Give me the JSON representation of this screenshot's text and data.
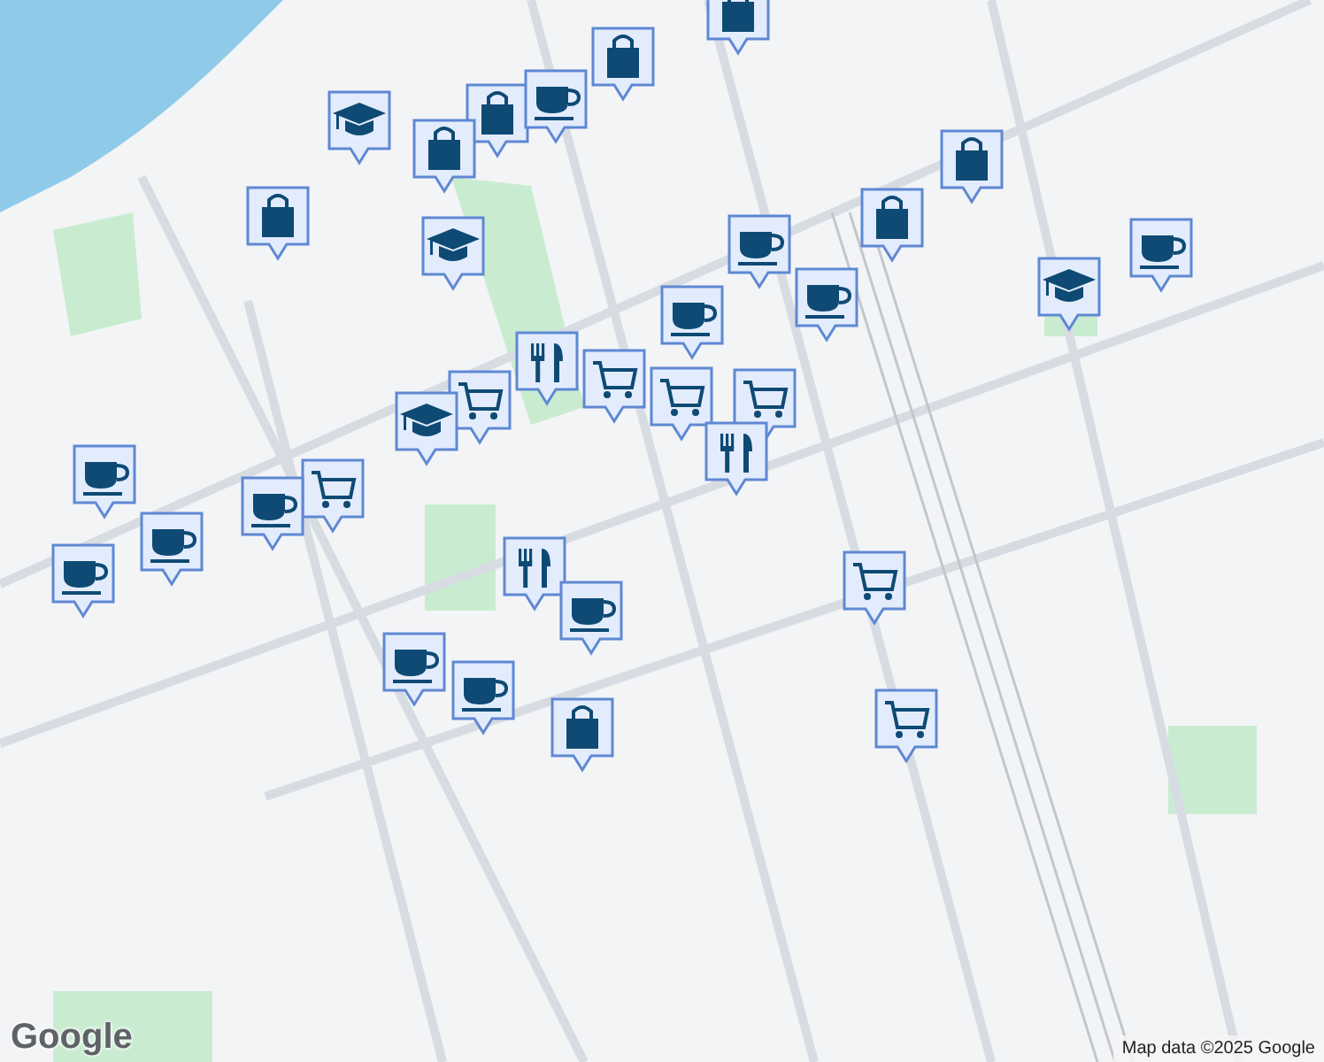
{
  "map": {
    "markers": [
      {
        "kind": "bag"
      },
      {
        "kind": "bag"
      },
      {
        "kind": "school"
      },
      {
        "kind": "bag"
      },
      {
        "kind": "cup"
      },
      {
        "kind": "bag"
      },
      {
        "kind": "bag"
      },
      {
        "kind": "school"
      },
      {
        "kind": "bag"
      },
      {
        "kind": "bag"
      },
      {
        "kind": "cup"
      },
      {
        "kind": "school"
      },
      {
        "kind": "cup"
      },
      {
        "kind": "cup"
      },
      {
        "kind": "cup"
      },
      {
        "kind": "cart"
      },
      {
        "kind": "fork"
      },
      {
        "kind": "cart"
      },
      {
        "kind": "cart"
      },
      {
        "kind": "school"
      },
      {
        "kind": "cart"
      },
      {
        "kind": "fork"
      },
      {
        "kind": "cart"
      },
      {
        "kind": "cup"
      },
      {
        "kind": "cup"
      },
      {
        "kind": "cup"
      },
      {
        "kind": "cup"
      },
      {
        "kind": "fork"
      },
      {
        "kind": "cup"
      },
      {
        "kind": "cup"
      },
      {
        "kind": "cup"
      },
      {
        "kind": "bag"
      },
      {
        "kind": "cart"
      },
      {
        "kind": "cart"
      }
    ]
  },
  "logo": "Google",
  "attribution": "Map data ©2025 Google"
}
